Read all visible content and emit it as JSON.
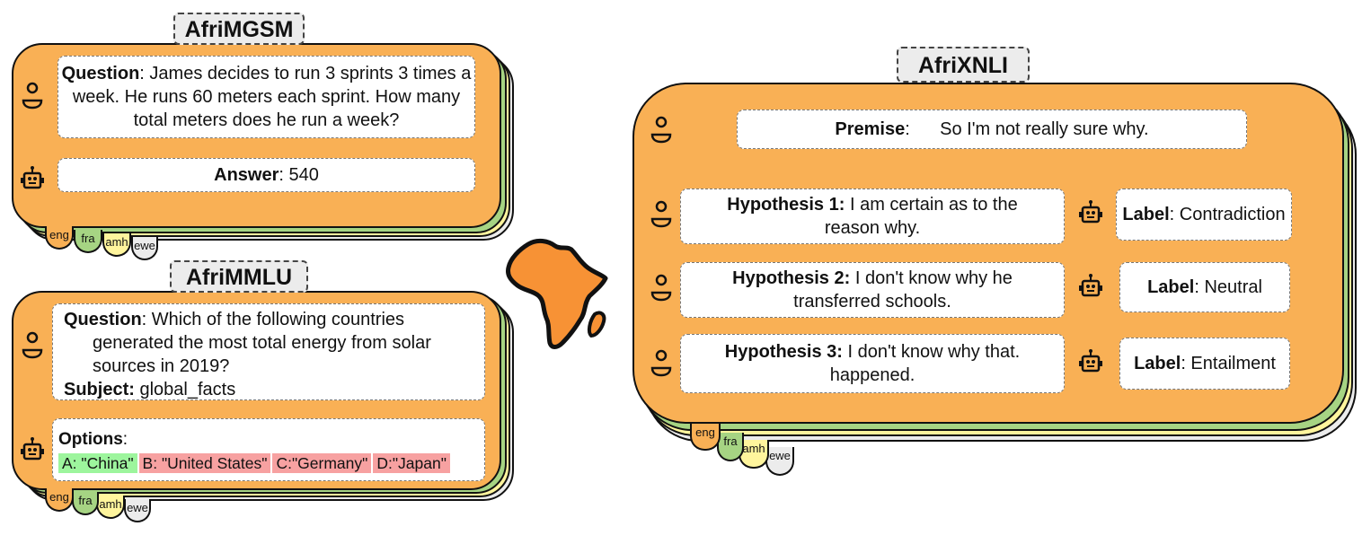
{
  "afrimgsm": {
    "title": "AfriMGSM",
    "question_label": "Question",
    "question_text": ": James decides to run 3 sprints 3 times a week. He runs 60 meters each sprint. How many total meters does he run a week?",
    "answer_label": "Answer",
    "answer_text": ": 540"
  },
  "afrimmlu": {
    "title": "AfriMMLU",
    "question_label": "Question",
    "question_text": ": Which of the following countries generated the most total energy from solar sources in 2019?",
    "subject_label": "Subject:",
    "subject_text": " global_facts",
    "options_label": "Options",
    "options_colon": ":",
    "options": [
      {
        "text": "A: \"China\"",
        "color": "#9df59d"
      },
      {
        "text": "B: \"United States\"",
        "color": "#f7a1a1"
      },
      {
        "text": "C:\"Germany\"",
        "color": "#f7a1a1"
      },
      {
        "text": "D:\"Japan\"",
        "color": "#f7a1a1"
      }
    ]
  },
  "afrixnli": {
    "title": "AfriXNLI",
    "premise_label": "Premise",
    "premise_text": ":      So I'm not really sure why.",
    "hypotheses": [
      {
        "label": "Hypothesis 1:",
        "text": " I am certain as to the reason why.",
        "label_key": "Label",
        "label_value": ": Contradiction"
      },
      {
        "label": "Hypothesis 2:",
        "text": " I don't know why he transferred schools.",
        "label_key": "Label",
        "label_value": ": Neutral"
      },
      {
        "label": "Hypothesis 3:",
        "text": " I don't know why that. happened.",
        "label_key": "Label",
        "label_value": ": Entailment"
      }
    ]
  },
  "languages": [
    "eng",
    "fra",
    "amh",
    "ewe"
  ],
  "colors": {
    "orange": "#f9b055",
    "green": "#a6d483",
    "yellow": "#fff59d",
    "gray": "#ececec",
    "africa": "#f79235",
    "correct": "#9df59d",
    "wrong": "#f7a1a1"
  },
  "icons": {
    "user": "user-icon",
    "robot": "robot-icon",
    "africa": "africa-map-icon"
  }
}
